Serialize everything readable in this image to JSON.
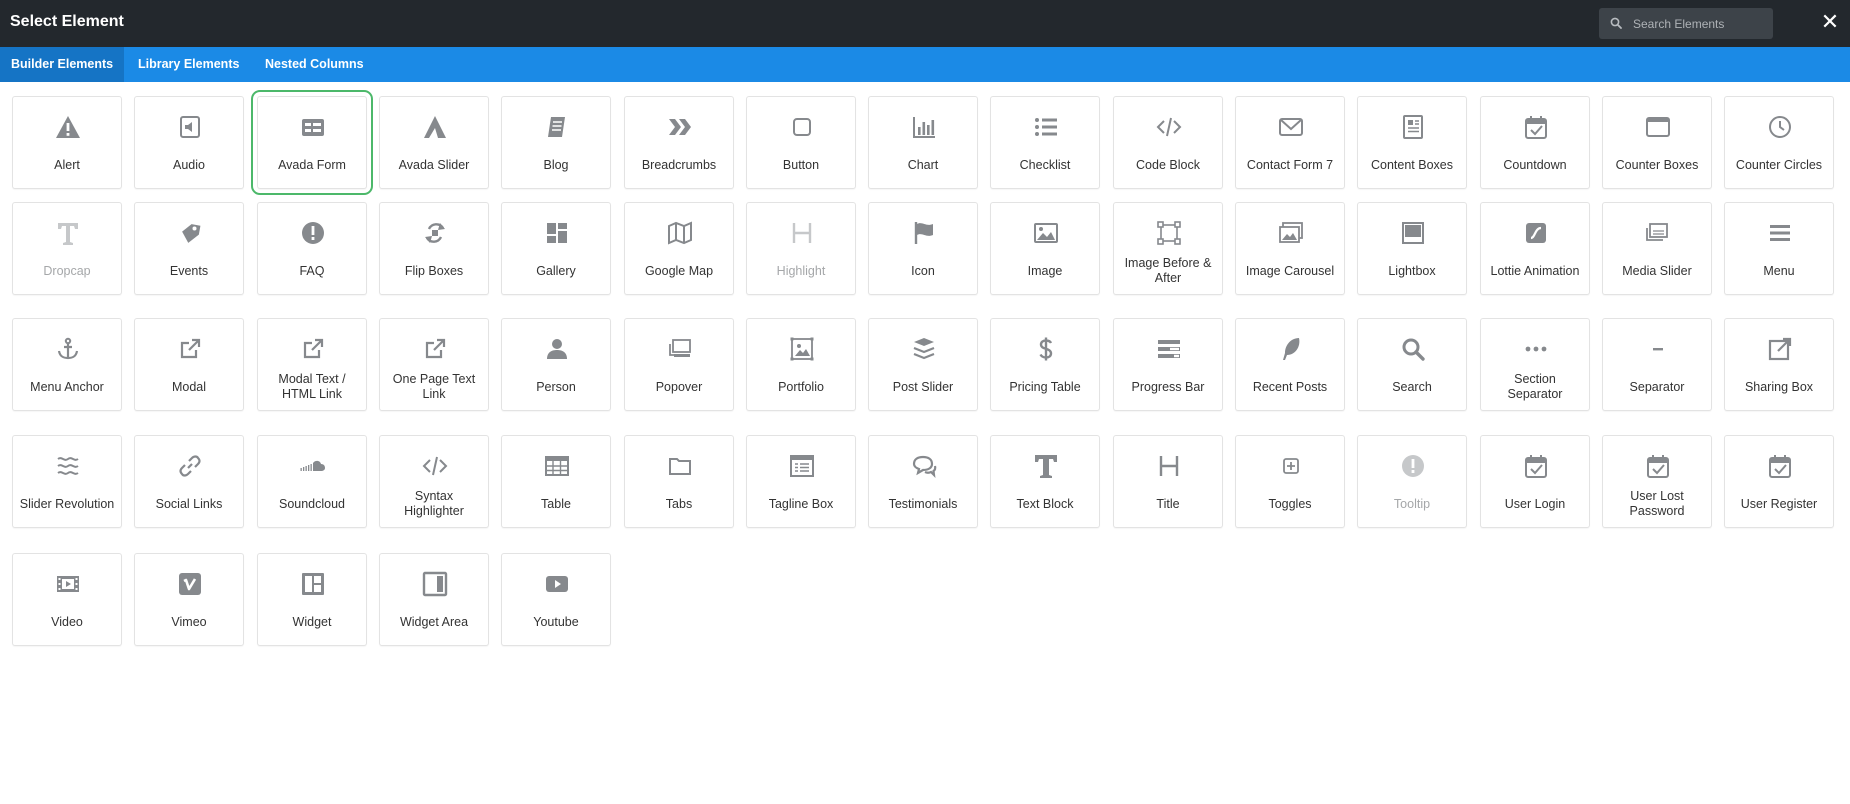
{
  "header": {
    "title": "Select Element",
    "search_placeholder": "Search Elements",
    "close_glyph": "✕"
  },
  "tabs": [
    {
      "label": "Builder Elements",
      "active": true
    },
    {
      "label": "Library Elements",
      "active": false
    },
    {
      "label": "Nested Columns",
      "active": false
    }
  ],
  "colors": {
    "topbar": "#23282d",
    "tabbar": "#1b8ae6",
    "active_tab": "#1574c5",
    "selected_outline": "#4cb86a",
    "icon": "#86898d"
  },
  "elements": [
    {
      "label": "Alert",
      "icon": "alert-icon"
    },
    {
      "label": "Audio",
      "icon": "audio-icon"
    },
    {
      "label": "Avada Form",
      "icon": "form-icon",
      "selected": true
    },
    {
      "label": "Avada Slider",
      "icon": "avada-slider-icon"
    },
    {
      "label": "Blog",
      "icon": "blog-icon"
    },
    {
      "label": "Breadcrumbs",
      "icon": "breadcrumbs-icon"
    },
    {
      "label": "Button",
      "icon": "button-icon"
    },
    {
      "label": "Chart",
      "icon": "chart-icon"
    },
    {
      "label": "Checklist",
      "icon": "checklist-icon"
    },
    {
      "label": "Code Block",
      "icon": "code-icon"
    },
    {
      "label": "Contact Form 7",
      "icon": "envelope-icon"
    },
    {
      "label": "Content Boxes",
      "icon": "content-boxes-icon"
    },
    {
      "label": "Countdown",
      "icon": "calendar-check-icon"
    },
    {
      "label": "Counter Boxes",
      "icon": "counter-boxes-icon"
    },
    {
      "label": "Counter Circles",
      "icon": "clock-icon"
    },
    {
      "label": "Dropcap",
      "icon": "dropcap-icon",
      "dim": true
    },
    {
      "label": "Events",
      "icon": "tag-icon"
    },
    {
      "label": "FAQ",
      "icon": "exclamation-circle-icon"
    },
    {
      "label": "Flip Boxes",
      "icon": "flip-icon"
    },
    {
      "label": "Gallery",
      "icon": "gallery-icon"
    },
    {
      "label": "Google Map",
      "icon": "map-icon"
    },
    {
      "label": "Highlight",
      "icon": "highlight-icon",
      "dim": true
    },
    {
      "label": "Icon",
      "icon": "flag-icon"
    },
    {
      "label": "Image",
      "icon": "image-icon"
    },
    {
      "label": "Image Before & After",
      "icon": "before-after-icon"
    },
    {
      "label": "Image Carousel",
      "icon": "images-icon"
    },
    {
      "label": "Lightbox",
      "icon": "lightbox-icon"
    },
    {
      "label": "Lottie Animation",
      "icon": "lottie-icon"
    },
    {
      "label": "Media Slider",
      "icon": "media-slider-icon"
    },
    {
      "label": "Menu",
      "icon": "menu-icon"
    },
    {
      "label": "Menu Anchor",
      "icon": "anchor-icon"
    },
    {
      "label": "Modal",
      "icon": "external-link-icon"
    },
    {
      "label": "Modal Text / HTML Link",
      "icon": "external-link-icon"
    },
    {
      "label": "One Page Text Link",
      "icon": "external-link-icon"
    },
    {
      "label": "Person",
      "icon": "person-icon"
    },
    {
      "label": "Popover",
      "icon": "popover-icon"
    },
    {
      "label": "Portfolio",
      "icon": "portfolio-icon"
    },
    {
      "label": "Post Slider",
      "icon": "post-slider-icon"
    },
    {
      "label": "Pricing Table",
      "icon": "dollar-icon"
    },
    {
      "label": "Progress Bar",
      "icon": "progress-bar-icon"
    },
    {
      "label": "Recent Posts",
      "icon": "feather-icon"
    },
    {
      "label": "Search",
      "icon": "search-icon"
    },
    {
      "label": "Section Separator",
      "icon": "dots-icon"
    },
    {
      "label": "Separator",
      "icon": "minus-icon"
    },
    {
      "label": "Sharing Box",
      "icon": "share-icon"
    },
    {
      "label": "Slider Revolution",
      "icon": "waves-icon"
    },
    {
      "label": "Social Links",
      "icon": "link-icon"
    },
    {
      "label": "Soundcloud",
      "icon": "soundcloud-icon"
    },
    {
      "label": "Syntax Highlighter",
      "icon": "code-icon"
    },
    {
      "label": "Table",
      "icon": "table-icon"
    },
    {
      "label": "Tabs",
      "icon": "folder-icon"
    },
    {
      "label": "Tagline Box",
      "icon": "tagline-box-icon"
    },
    {
      "label": "Testimonials",
      "icon": "comments-icon"
    },
    {
      "label": "Text Block",
      "icon": "text-block-icon"
    },
    {
      "label": "Title",
      "icon": "title-icon"
    },
    {
      "label": "Toggles",
      "icon": "plus-square-icon"
    },
    {
      "label": "Tooltip",
      "icon": "exclamation-circle-icon",
      "dim": true
    },
    {
      "label": "User Login",
      "icon": "calendar-check-icon"
    },
    {
      "label": "User Lost Password",
      "icon": "calendar-check-icon"
    },
    {
      "label": "User Register",
      "icon": "calendar-check-icon"
    },
    {
      "label": "Video",
      "icon": "film-icon"
    },
    {
      "label": "Vimeo",
      "icon": "vimeo-icon"
    },
    {
      "label": "Widget",
      "icon": "widget-icon"
    },
    {
      "label": "Widget Area",
      "icon": "widget-area-icon"
    },
    {
      "label": "Youtube",
      "icon": "youtube-icon"
    }
  ]
}
